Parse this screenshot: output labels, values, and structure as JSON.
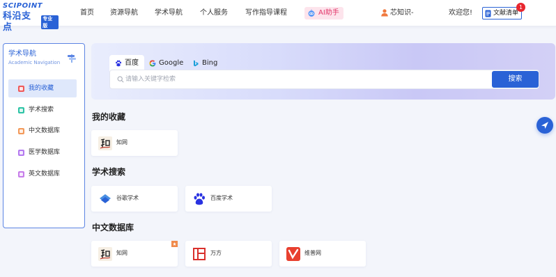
{
  "header": {
    "logo": {
      "text_top": "SCIPOINT",
      "text_cn": "科沿支点",
      "tag": "专业版"
    },
    "nav": [
      "首页",
      "资源导航",
      "学术导航",
      "个人服务",
      "写作指导课程"
    ],
    "ai_button": "AI助手",
    "user_name": "芯知识-",
    "welcome": "欢迎您!",
    "doc_list": "文献清单",
    "doc_badge": "1"
  },
  "sidebar": {
    "title": "学术导航",
    "subtitle": "Academic Navigation",
    "items": [
      {
        "label": "我的收藏",
        "icon": "favorites-icon",
        "color": "#ef5a5a",
        "active": true
      },
      {
        "label": "学术搜索",
        "icon": "search-category-icon",
        "color": "#2ec4a6",
        "active": false
      },
      {
        "label": "中文数据库",
        "icon": "database-icon",
        "color": "#f39a5b",
        "active": false
      },
      {
        "label": "医学数据库",
        "icon": "medical-icon",
        "color": "#b479f0",
        "active": false
      },
      {
        "label": "英文数据库",
        "icon": "english-db-icon",
        "color": "#c77dea",
        "active": false
      }
    ]
  },
  "search": {
    "tabs": [
      {
        "label": "百度",
        "icon": "baidu-icon",
        "active": true
      },
      {
        "label": "Google",
        "icon": "google-icon",
        "active": false
      },
      {
        "label": "Bing",
        "icon": "bing-icon",
        "active": false
      }
    ],
    "placeholder": "请输入关键字检索",
    "value": "",
    "button": "搜索"
  },
  "sections": [
    {
      "title": "我的收藏",
      "cards": [
        {
          "label": "知网",
          "icon": "cnki-icon",
          "starred": false
        }
      ]
    },
    {
      "title": "学术搜索",
      "cards": [
        {
          "label": "谷歌学术",
          "icon": "google-scholar-icon",
          "starred": false
        },
        {
          "label": "百度学术",
          "icon": "baidu-scholar-icon",
          "starred": false
        }
      ]
    },
    {
      "title": "中文数据库",
      "cards": [
        {
          "label": "知网",
          "icon": "cnki-icon",
          "starred": true
        },
        {
          "label": "万方",
          "icon": "wanfang-icon",
          "starred": false
        },
        {
          "label": "维普网",
          "icon": "vip-icon",
          "starred": false
        }
      ]
    }
  ],
  "colors": {
    "accent": "#2a62d6",
    "ai_pink": "#e2376a",
    "badge_red": "#e8262e"
  }
}
